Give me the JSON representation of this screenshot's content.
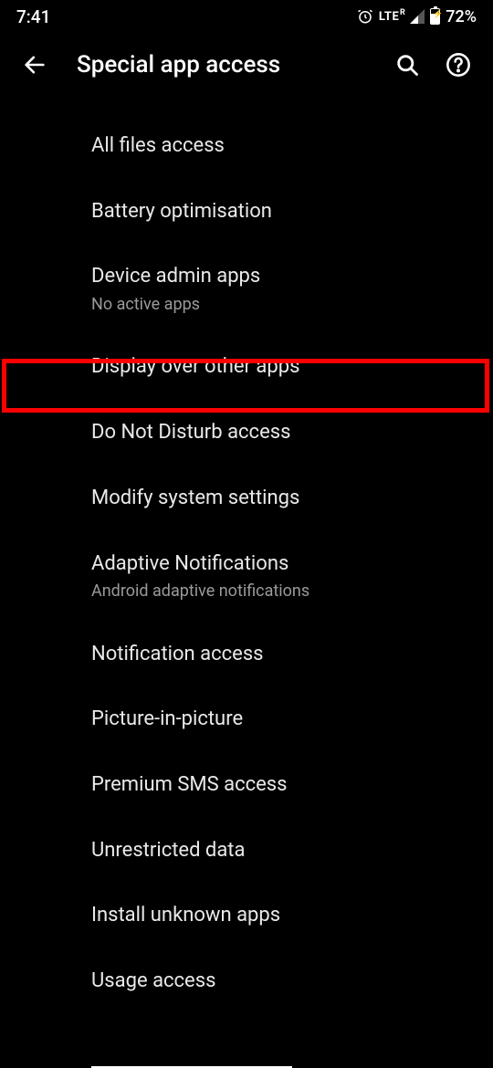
{
  "status": {
    "time": "7:41",
    "lte_label": "LTE",
    "lte_roaming": "R",
    "battery_pct": "72%"
  },
  "header": {
    "title": "Special app access"
  },
  "items": [
    {
      "title": "All files access",
      "subtitle": null
    },
    {
      "title": "Battery optimisation",
      "subtitle": null
    },
    {
      "title": "Device admin apps",
      "subtitle": "No active apps"
    },
    {
      "title": "Display over other apps",
      "subtitle": null,
      "highlighted": true
    },
    {
      "title": "Do Not Disturb access",
      "subtitle": null
    },
    {
      "title": "Modify system settings",
      "subtitle": null
    },
    {
      "title": "Adaptive Notifications",
      "subtitle": "Android adaptive notifications"
    },
    {
      "title": "Notification access",
      "subtitle": null
    },
    {
      "title": "Picture-in-picture",
      "subtitle": null
    },
    {
      "title": "Premium SMS access",
      "subtitle": null
    },
    {
      "title": "Unrestricted data",
      "subtitle": null
    },
    {
      "title": "Install unknown apps",
      "subtitle": null
    },
    {
      "title": "Usage access",
      "subtitle": null
    }
  ]
}
